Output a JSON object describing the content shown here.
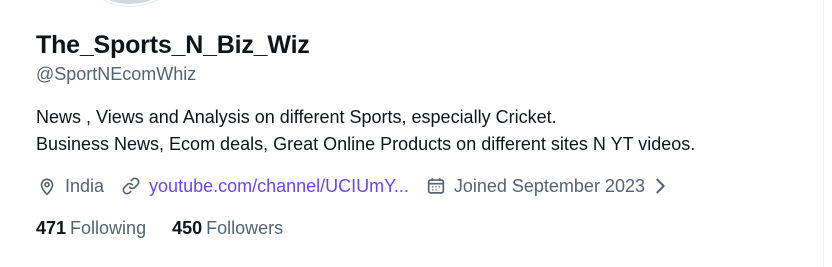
{
  "profile": {
    "display_name": "The_Sports_N_Biz_Wiz",
    "handle": "@SportNEcomWhiz",
    "bio_lines": [
      "News , Views and Analysis on different Sports, especially Cricket.",
      "Business News, Ecom deals, Great Online Products on different sites N YT videos."
    ],
    "location": "India",
    "website": "youtube.com/channel/UCIUmY...",
    "joined": "Joined September 2023",
    "following_count": "471",
    "following_label": "Following",
    "followers_count": "450",
    "followers_label": "Followers"
  },
  "icons": {
    "location": "location-pin-icon",
    "link": "link-icon",
    "calendar": "calendar-icon",
    "more": "chevron-right-icon"
  },
  "colors": {
    "text": "#0f1419",
    "secondary": "#536471",
    "link": "#6b46f5"
  }
}
